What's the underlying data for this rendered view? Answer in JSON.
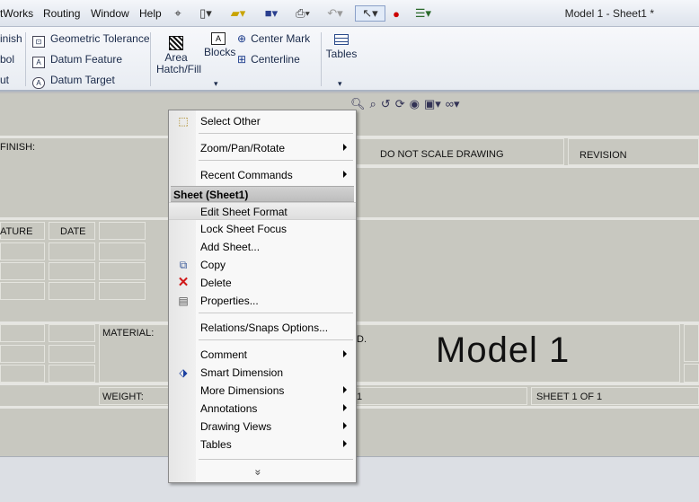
{
  "window": {
    "title": "Model 1 - Sheet1 *"
  },
  "menubar": {
    "items": [
      "tWorks",
      "Routing",
      "Window",
      "Help"
    ]
  },
  "ribbon": {
    "left_items": [
      "inish",
      "bol",
      "ut"
    ],
    "annotations": [
      "Geometric Tolerance",
      "Datum Feature",
      "Datum Target"
    ],
    "area_hatch": "Area\nHatch/Fill",
    "blocks": "Blocks",
    "center": [
      "Center Mark",
      "Centerline"
    ],
    "tables": "Tables"
  },
  "sheet": {
    "finish": "FINISH:",
    "do_not_scale": "DO NOT SCALE DRAWING",
    "revision": "REVISION",
    "ature": "ATURE",
    "date": "DATE",
    "material": "MATERIAL:",
    "weight": "WEIGHT:",
    "model": "Model 1",
    "sheet_of": "SHEET 1  OF 1",
    "dwg_frag": "D.",
    "scale_frag": "1"
  },
  "context_menu": {
    "items": [
      {
        "label": "Select Other"
      },
      {
        "label": "Zoom/Pan/Rotate"
      },
      {
        "label": "Recent Commands"
      },
      {
        "label": "Edit Sheet Format"
      },
      {
        "label": "Lock Sheet Focus"
      },
      {
        "label": "Add Sheet..."
      },
      {
        "label": "Copy"
      },
      {
        "label": "Delete"
      },
      {
        "label": "Properties..."
      },
      {
        "label": "Relations/Snaps Options..."
      },
      {
        "label": "Comment"
      },
      {
        "label": "Smart Dimension"
      },
      {
        "label": "More Dimensions"
      },
      {
        "label": "Annotations"
      },
      {
        "label": "Drawing Views"
      },
      {
        "label": "Tables"
      }
    ],
    "section_header": "Sheet (Sheet1)",
    "expand": "»"
  }
}
